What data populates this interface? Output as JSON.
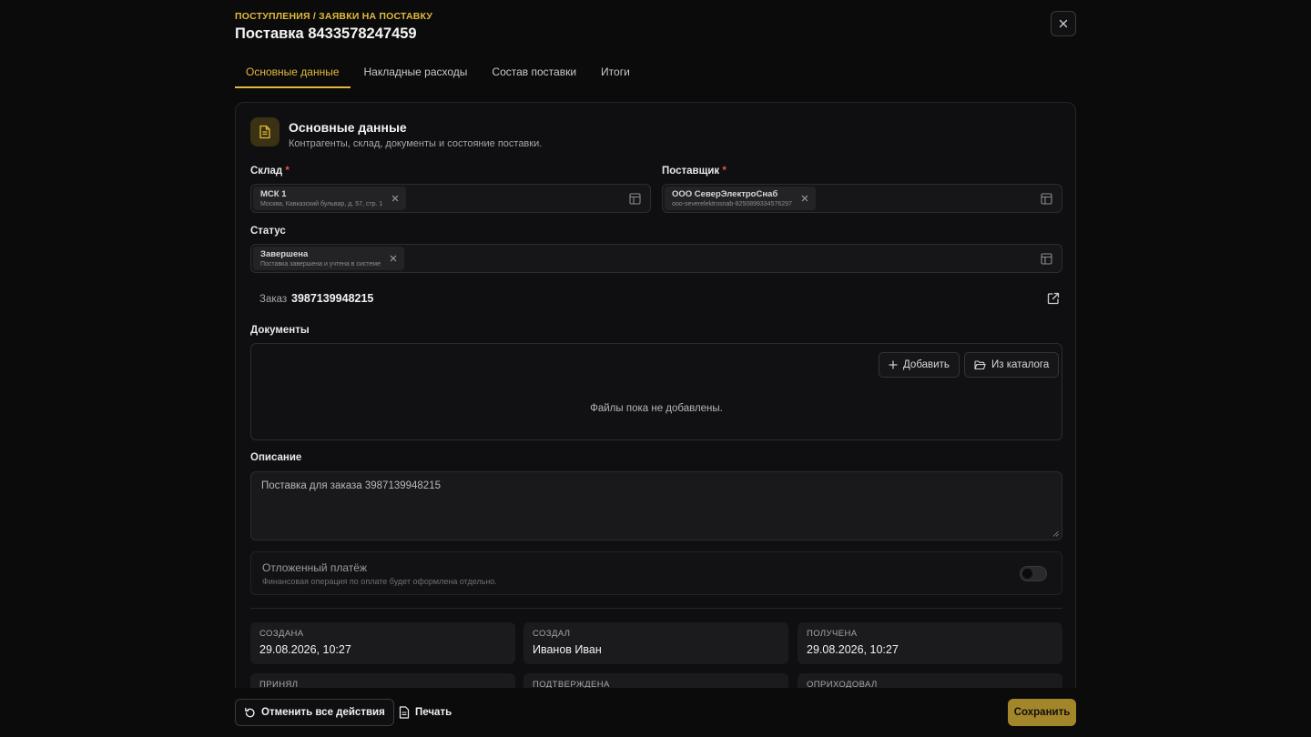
{
  "header": {
    "breadcrumb": "ПОСТУПЛЕНИЯ / ЗАЯВКИ НА ПОСТАВКУ",
    "title": "Поставка 8433578247459"
  },
  "tabs": [
    {
      "label": "Основные данные"
    },
    {
      "label": "Накладные расходы"
    },
    {
      "label": "Состав поставки"
    },
    {
      "label": "Итоги"
    }
  ],
  "section": {
    "title": "Основные данные",
    "subtitle": "Контрагенты, склад, документы и состояние поставки."
  },
  "fields": {
    "warehouse": {
      "label": "Склад",
      "required": "*",
      "value": "МСК 1",
      "sub": "Москва, Кавказский бульвар, д. 57, стр. 1"
    },
    "supplier": {
      "label": "Поставщик",
      "required": "*",
      "value": "ООО СеверЭлектроСнаб",
      "sub": "ooo-severelektrosnab-8250899334576297"
    },
    "status": {
      "label": "Статус",
      "value": "Завершена",
      "sub": "Поставка завершена и учтена в системе"
    }
  },
  "order": {
    "label": "Заказ",
    "value": "3987139948215"
  },
  "documents": {
    "label": "Документы",
    "add_label": "Добавить",
    "catalog_label": "Из каталога",
    "empty_text": "Файлы пока не добавлены."
  },
  "description": {
    "label": "Описание",
    "value": "Поставка для заказа 3987139948215"
  },
  "deferred": {
    "title": "Отложенный платёж",
    "subtitle": "Финансовая операция по оплате будет оформлена отдельно.",
    "enabled": false
  },
  "stats": [
    {
      "label": "СОЗДАНА",
      "value": "29.08.2026, 10:27"
    },
    {
      "label": "СОЗДАЛ",
      "value": "Иванов Иван"
    },
    {
      "label": "ПОЛУЧЕНА",
      "value": "29.08.2026, 10:27"
    },
    {
      "label": "ПРИНЯЛ",
      "value": ""
    },
    {
      "label": "ПОДТВЕРЖДЕНА",
      "value": ""
    },
    {
      "label": "ОПРИХОДОВАЛ",
      "value": ""
    }
  ],
  "footer": {
    "undo_label": "Отменить все действия",
    "print_label": "Печать",
    "save_label": "Сохранить"
  },
  "colors": {
    "accent": "#e2b93b",
    "save": "#a3852a",
    "background": "#0b0b0c"
  }
}
